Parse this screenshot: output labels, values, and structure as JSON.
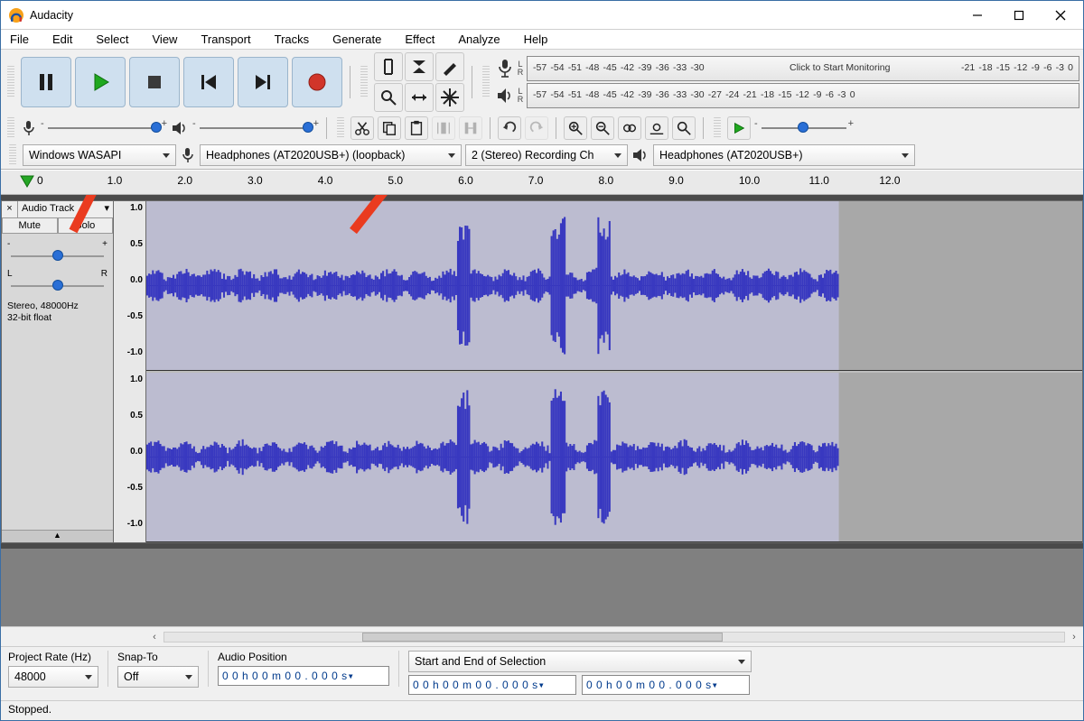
{
  "window": {
    "title": "Audacity"
  },
  "menu": [
    "File",
    "Edit",
    "Select",
    "View",
    "Transport",
    "Tracks",
    "Generate",
    "Effect",
    "Analyze",
    "Help"
  ],
  "transport": {
    "buttons": [
      "pause",
      "play",
      "stop",
      "skip-start",
      "skip-end",
      "record"
    ]
  },
  "meter": {
    "ticks": [
      "-57",
      "-54",
      "-51",
      "-48",
      "-45",
      "-42",
      "-39",
      "-36",
      "-33",
      "-30",
      "-27",
      "-24",
      "-21",
      "-18",
      "-15",
      "-12",
      "-9",
      "-6",
      "-3",
      "0"
    ],
    "rec_hint": "Click to Start Monitoring"
  },
  "device": {
    "host": "Windows WASAPI",
    "rec_device": "Headphones (AT2020USB+) (loopback)",
    "rec_channels": "2 (Stereo) Recording Ch",
    "play_device": "Headphones (AT2020USB+)"
  },
  "timeline": {
    "labels": [
      "0",
      "1.0",
      "2.0",
      "3.0",
      "4.0",
      "5.0",
      "6.0",
      "7.0",
      "8.0",
      "9.0",
      "10.0",
      "11.0",
      "12.0"
    ]
  },
  "track": {
    "name": "Audio Track",
    "mute": "Mute",
    "solo": "Solo",
    "pan_left": "L",
    "pan_right": "R",
    "gain_minus": "-",
    "gain_plus": "+",
    "info1": "Stereo, 48000Hz",
    "info2": "32-bit float",
    "vscale": [
      "1.0",
      "0.5",
      "0.0",
      "-0.5",
      "-1.0"
    ]
  },
  "selection": {
    "rate_label": "Project Rate (Hz)",
    "rate_value": "48000",
    "snap_label": "Snap-To",
    "snap_value": "Off",
    "pos_label": "Audio Position",
    "pos_value": "0 0 h 0 0 m 0 0 . 0 0 0 s",
    "sel_label": "Start and End of Selection",
    "sel_start": "0 0 h 0 0 m 0 0 . 0 0 0 s",
    "sel_end": "0 0 h 0 0 m 0 0 . 0 0 0 s"
  },
  "status": "Stopped."
}
